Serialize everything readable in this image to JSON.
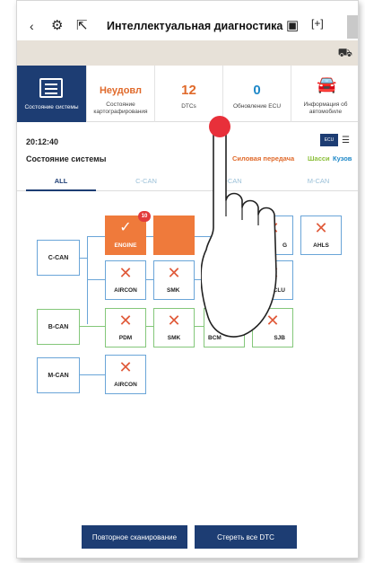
{
  "header": {
    "title": "Интеллектуальная диагностика",
    "icons": [
      "back-icon",
      "gear-icon",
      "export-icon",
      "camera-icon",
      "expand-icon",
      "overflow-icon",
      "car-icon"
    ]
  },
  "cards": {
    "system_state_label": "Состояние системы",
    "map_value": "Неудовл",
    "map_label": "Состояние картографирования",
    "dtc_value": "12",
    "dtc_label": "DTCs",
    "ecu_value": "0",
    "ecu_label": "Обновление ECU",
    "vehicle_label": "Информация об автомобиле"
  },
  "status": {
    "time": "20:12:40",
    "ecu_select": "ECU",
    "section_title": "Состояние системы",
    "cat_powertrain": "Силовая передача",
    "cat_chassis": "Шасси",
    "cat_body": "Кузов"
  },
  "tabs": [
    "ALL",
    "C-CAN",
    "B-CAN",
    "M-CAN"
  ],
  "diagram": {
    "buses": [
      "C-CAN",
      "B-CAN",
      "M-CAN"
    ],
    "ecus": {
      "engine": "ENGINE",
      "engine_badge": "10",
      "g": "G",
      "ahls": "AHLS",
      "aircon1": "AIRCON",
      "smk1": "SMK",
      "clu": "CLU",
      "pdm": "PDM",
      "smk2": "SMK",
      "bcm": "BCM",
      "sjb": "SJB",
      "aircon2": "AIRCON"
    }
  },
  "colors": {
    "primary": "#1d3d73",
    "error": "#ef7a3b",
    "accent_blue": "#1e88c8",
    "powertrain": "#e06a2b",
    "chassis": "#8bbf3a",
    "body": "#1e88c8"
  },
  "footer": {
    "rescan": "Повторное сканирование",
    "clear_dtc": "Стереть все DTC"
  }
}
